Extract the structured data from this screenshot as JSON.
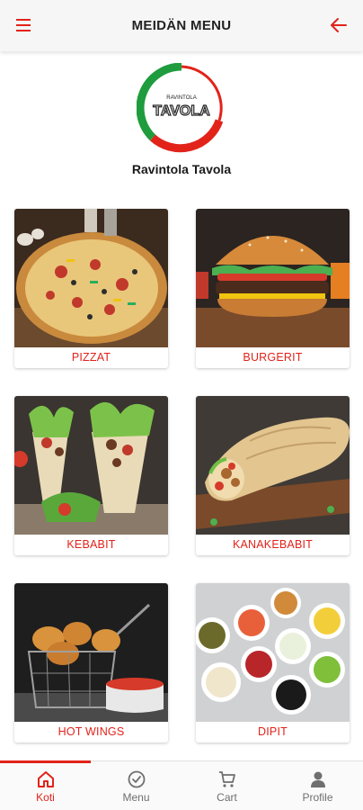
{
  "header": {
    "title": "MEIDÄN MENU",
    "menu_icon": "hamburger-icon",
    "back_icon": "arrow-left-icon"
  },
  "brand": {
    "logo_text_top": "RAVINTOLA",
    "logo_text": "TAVOLA",
    "name": "Ravintola Tavola",
    "colors": {
      "green": "#1f9c3d",
      "red": "#e2231a",
      "dark": "#222222"
    }
  },
  "categories": [
    {
      "label": "PIZZAT"
    },
    {
      "label": "BURGERIT"
    },
    {
      "label": "KEBABIT"
    },
    {
      "label": "KANAKEBABIT"
    },
    {
      "label": "HOT WINGS"
    },
    {
      "label": "DIPIT"
    }
  ],
  "bottom_nav": [
    {
      "label": "Koti",
      "icon": "home-icon",
      "active": true
    },
    {
      "label": "Menu",
      "icon": "check-circle-icon",
      "active": false
    },
    {
      "label": "Cart",
      "icon": "cart-icon",
      "active": false
    },
    {
      "label": "Profile",
      "icon": "person-icon",
      "active": false
    }
  ],
  "colors": {
    "accent": "#e2231a",
    "inactive": "#6f6f6f"
  }
}
